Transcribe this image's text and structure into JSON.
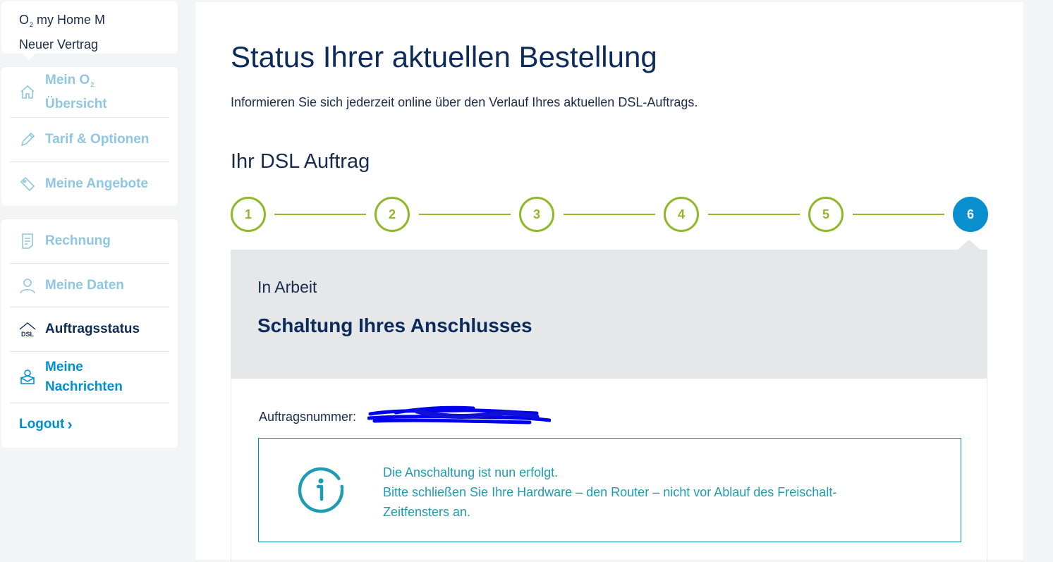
{
  "contract": {
    "brand_o": "O",
    "brand_sub": "2",
    "name": "my Home M",
    "subtitle": "Neuer Vertrag"
  },
  "nav_top": [
    {
      "label": "Mein O",
      "label_sub": "2",
      "label_line2": "Übersicht",
      "icon": "home-icon"
    },
    {
      "label": "Tarif & Optionen",
      "icon": "pencil-icon"
    },
    {
      "label": "Meine Angebote",
      "icon": "tag-icon"
    }
  ],
  "nav_bottom": [
    {
      "label": "Rechnung",
      "icon": "invoice-icon"
    },
    {
      "label": "Meine Daten",
      "icon": "user-icon"
    },
    {
      "label": "Auftragsstatus",
      "icon": "dsl-icon",
      "active": true
    },
    {
      "label": "Meine",
      "label_line2": "Nachrichten",
      "icon": "messages-icon"
    },
    {
      "label": "Logout",
      "arrow": "›"
    }
  ],
  "main": {
    "title": "Status Ihrer aktuellen Bestellung",
    "intro": "Informieren Sie sich jederzeit online über den Verlauf Ihres aktuellen DSL-Auftrags.",
    "section_title": "Ihr DSL Auftrag",
    "steps": [
      "1",
      "2",
      "3",
      "4",
      "5",
      "6"
    ],
    "current_step": 6,
    "status_state": "In Arbeit",
    "status_title": "Schaltung Ihres Anschlusses",
    "order_label": "Auftragsnummer:",
    "info_lines": [
      "Die Anschaltung ist nun erfolgt.",
      "Bitte schließen Sie Ihre Hardware – den Router – nicht vor Ablauf des Freischalt-",
      "Zeitfensters an."
    ]
  },
  "colors": {
    "navy": "#0c2a5a",
    "green": "#8fb82a",
    "blue": "#0a8fcf",
    "teal": "#1d9cb3",
    "nav_inactive": "#8fc6e2",
    "status_bg": "#e5e7e9"
  }
}
